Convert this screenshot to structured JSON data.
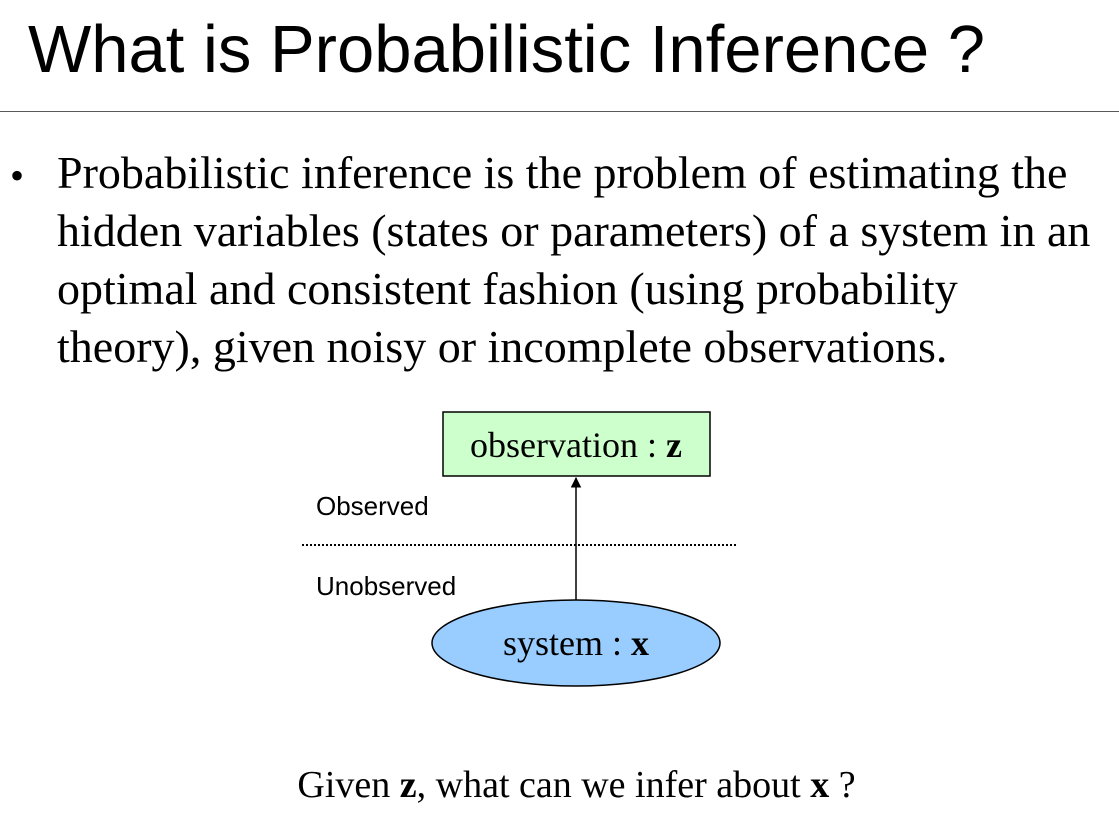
{
  "slide": {
    "title": "What is Probabilistic Inference ?",
    "bullet_symbol": "•",
    "bullet_lines": [
      "Probabilistic inference is the problem of estimating the",
      "hidden variables (states or parameters) of a system in an",
      "optimal and consistent fashion (using probability",
      "theory), given noisy or incomplete observations."
    ]
  },
  "diagram": {
    "observation_node": {
      "label": "observation : ",
      "variable": "z",
      "fill": "#ccffcc"
    },
    "system_node": {
      "label": "system : ",
      "variable": "x",
      "fill": "#99ccff"
    },
    "observed_label": "Observed",
    "unobserved_label": "Unobserved"
  },
  "question": {
    "prefix": "Given ",
    "observed_var": "z",
    "middle": ", what can we infer about ",
    "hidden_var": "x",
    "suffix": " ?"
  }
}
